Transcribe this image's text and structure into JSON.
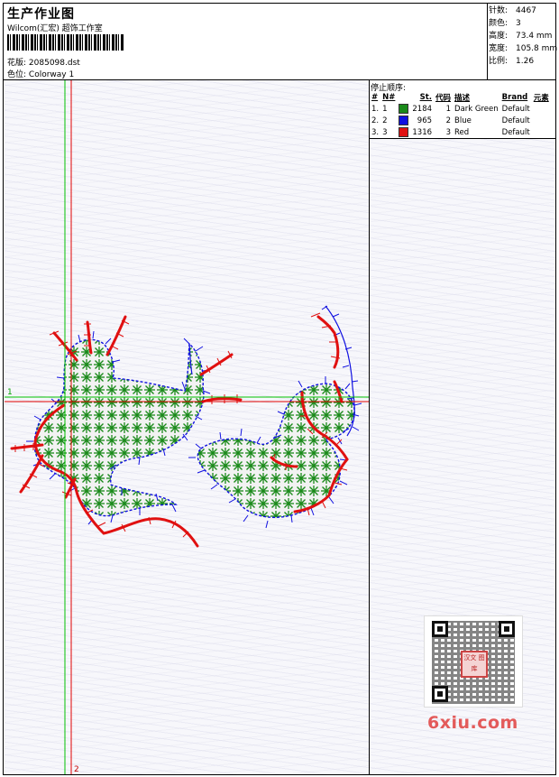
{
  "header": {
    "title": "生产作业图",
    "company": "Wilcom(汇宏) 超饰工作室",
    "design_label": "花版:",
    "design_value": "2085098.dst",
    "colorway_label": "色位:",
    "colorway_value": "Colorway 1"
  },
  "stats": [
    {
      "label": "针数:",
      "value": "4467"
    },
    {
      "label": "颜色:",
      "value": "3"
    },
    {
      "label": "高度:",
      "value": "73.4 mm"
    },
    {
      "label": "宽度:",
      "value": "105.8 mm"
    },
    {
      "label": "比例:",
      "value": "1.26"
    }
  ],
  "stop_sequence": {
    "title": "停止顺序:",
    "headers": [
      "#",
      "N#",
      "St.",
      "代码",
      "描述",
      "Brand",
      "元素"
    ],
    "rows": [
      {
        "idx": "1.",
        "n": "1",
        "color": "#1a8a1a",
        "stitches": "2184",
        "code": "1",
        "desc": "Dark Green",
        "brand": "Default"
      },
      {
        "idx": "2.",
        "n": "2",
        "color": "#1010e0",
        "stitches": "965",
        "code": "2",
        "desc": "Blue",
        "brand": "Default"
      },
      {
        "idx": "3.",
        "n": "3",
        "color": "#e01010",
        "stitches": "1316",
        "code": "3",
        "desc": "Red",
        "brand": "Default"
      }
    ]
  },
  "guides": {
    "h_label": "1",
    "v_label": "2"
  },
  "watermark": "6xiu.com",
  "qr_logo_text": "汉文 图库",
  "colors": {
    "green": "#1a8a1a",
    "blue": "#1010e0",
    "red": "#e01010",
    "guide_green": "#00c000",
    "guide_red": "#e00000"
  }
}
